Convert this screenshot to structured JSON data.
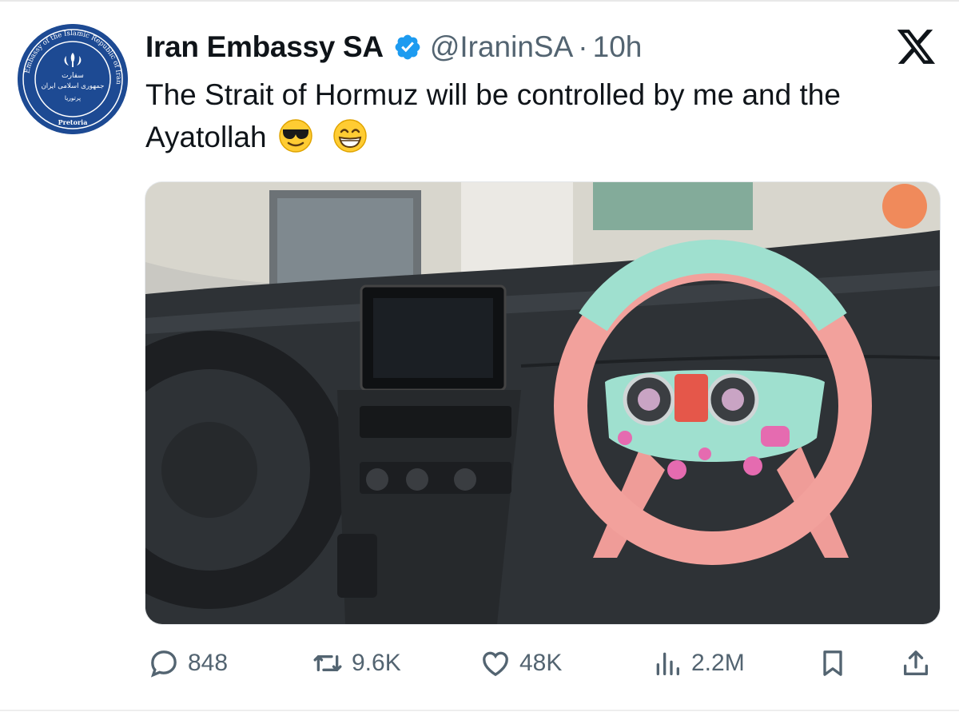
{
  "tweet": {
    "author_name": "Iran Embassy SA",
    "handle": "@IraninSA",
    "separator": "·",
    "time": "10h",
    "text": "The Strait of Hormuz will be controlled by me and the Ayatollah",
    "emojis": [
      "smiling-face-with-sunglasses",
      "beaming-face-with-smiling-eyes"
    ]
  },
  "avatar": {
    "ring_text": "Embassy of the Islamic Republic of Iran",
    "bottom_text": "Pretoria",
    "center_line_1": "سفارت",
    "center_line_2": "جمهوری اسلامی ایران",
    "center_line_3": "پرتوریا"
  },
  "actions": {
    "replies": "848",
    "reposts": "9.6K",
    "likes": "48K",
    "views": "2.2M"
  },
  "colors": {
    "text_primary": "#0f1419",
    "text_secondary": "#536471",
    "verified_blue": "#1d9bf0",
    "avatar_blue": "#1d4a93"
  },
  "icons": [
    "verified-badge-icon",
    "x-logo-icon",
    "reply-icon",
    "repost-icon",
    "like-icon",
    "views-icon",
    "bookmark-icon",
    "share-icon"
  ]
}
